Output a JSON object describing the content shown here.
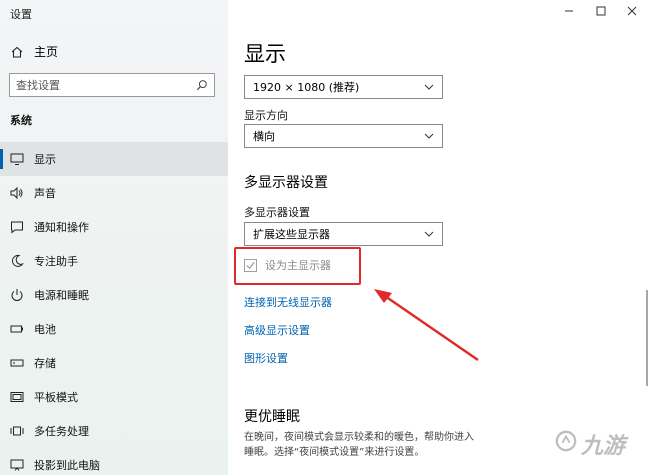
{
  "window": {
    "title": "设置"
  },
  "sidebar": {
    "home_label": "主页",
    "search_placeholder": "查找设置",
    "section_label": "系统",
    "items": [
      {
        "label": "显示",
        "icon": "monitor-icon",
        "active": true
      },
      {
        "label": "声音",
        "icon": "speaker-icon"
      },
      {
        "label": "通知和操作",
        "icon": "notification-icon"
      },
      {
        "label": "专注助手",
        "icon": "moon-icon"
      },
      {
        "label": "电源和睡眠",
        "icon": "power-icon"
      },
      {
        "label": "电池",
        "icon": "battery-icon"
      },
      {
        "label": "存储",
        "icon": "storage-icon"
      },
      {
        "label": "平板模式",
        "icon": "tablet-icon"
      },
      {
        "label": "多任务处理",
        "icon": "multitask-icon"
      },
      {
        "label": "投影到此电脑",
        "icon": "projector-icon"
      }
    ]
  },
  "main": {
    "title": "显示",
    "resolution_value": "1920 × 1080 (推荐)",
    "orientation_label": "显示方向",
    "orientation_value": "横向",
    "multi_heading": "多显示器设置",
    "multi_label": "多显示器设置",
    "multi_value": "扩展这些显示器",
    "primary_checkbox_label": "设为主显示器",
    "primary_checkbox_checked": true,
    "primary_checkbox_disabled": true,
    "links": [
      "连接到无线显示器",
      "高级显示设置",
      "图形设置"
    ],
    "sleep_heading": "更优睡眠",
    "sleep_desc": "在晚间，夜间模式会显示较柔和的暖色，帮助你进入睡眠。选择“夜间模式设置”来进行设置。"
  },
  "annotation": {
    "color": "#e02a2a"
  },
  "watermark": {
    "text": "九游"
  }
}
